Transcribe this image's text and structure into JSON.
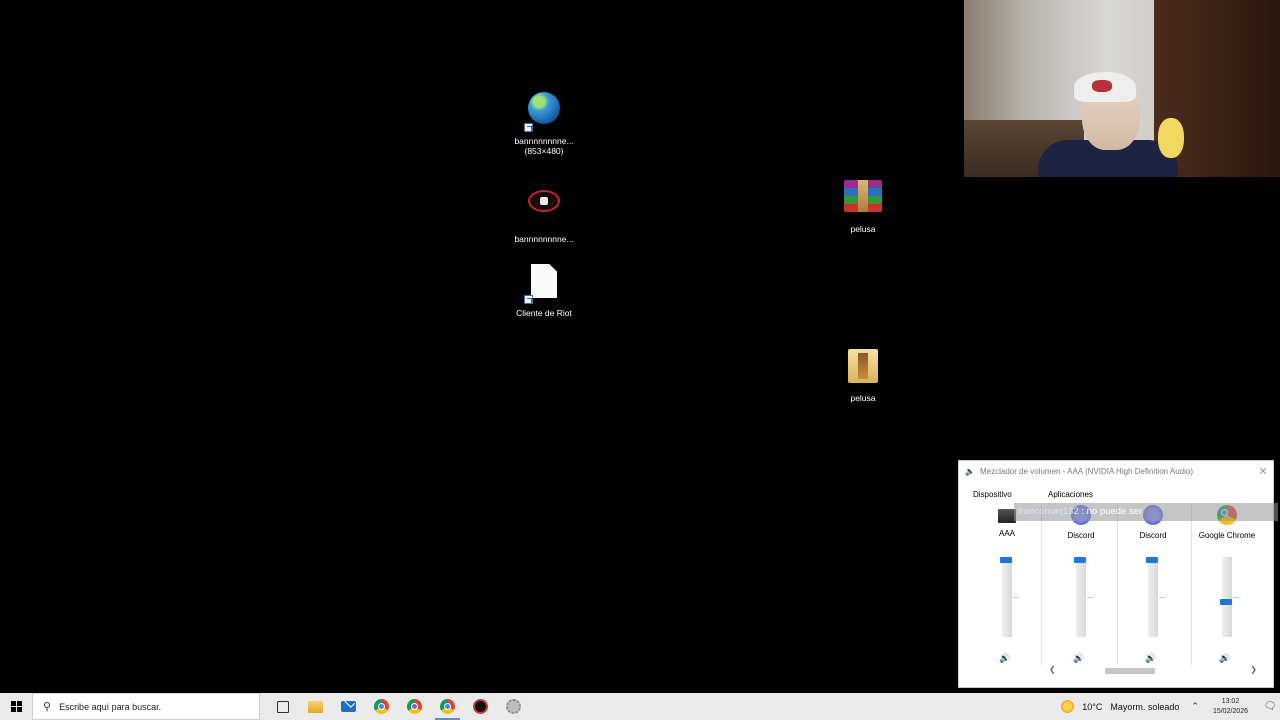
{
  "desktop": {
    "icons": [
      {
        "id": "bann-video",
        "label_line1": "bannnnnnnne...",
        "label_line2": "(853×480)"
      },
      {
        "id": "bann-app",
        "label": "bannnnnnnne..."
      },
      {
        "id": "riot-client",
        "label": "Cliente de Riot"
      },
      {
        "id": "pelusa-winrar",
        "label": "pelusa"
      },
      {
        "id": "pelusa-folder",
        "label": "pelusa"
      }
    ]
  },
  "mixer": {
    "title": "Mezclador de volumen - AAA (NVIDIA High Definition Audio)",
    "device_header": "Dispositivo",
    "apps_header": "Aplicaciones",
    "channels": [
      {
        "name": "AAA",
        "level": 0.95,
        "icon": "monitor-icon"
      },
      {
        "name": "Discord",
        "level": 0.95,
        "icon": "discord-icon"
      },
      {
        "name": "Discord",
        "level": 0.95,
        "icon": "discord-icon"
      },
      {
        "name": "Google Chrome",
        "level": 0.45,
        "icon": "chrome-icon"
      }
    ]
  },
  "chat_overlay": {
    "user": "francomaq132",
    "message": " : no puede ser"
  },
  "taskbar": {
    "search_placeholder": "Escribe aquí para buscar.",
    "weather_temp": "10°C",
    "weather_desc": "Mayorm. soleado",
    "time": "13:02",
    "date": "15/02/2026"
  },
  "colors": {
    "accent": "#1e78d6",
    "taskbar_bg": "#eaeaea",
    "desktop_bg": "#000000"
  }
}
